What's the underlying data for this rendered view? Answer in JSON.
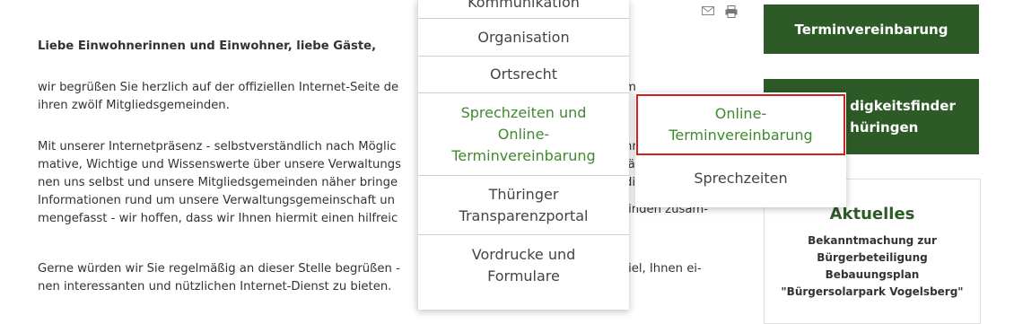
{
  "content": {
    "greeting": "Liebe Einwohnerinnen und Einwohner, liebe Gäste,",
    "p1_line1": "wir begrüßen Sie herzlich auf der offiziellen Internet-Seite de",
    "p1_line2": "ihren zwölf Mitgliedsgemeinden.",
    "p2_line1": "Mit unserer Internetpräsenz - selbstverständlich nach Möglic",
    "p2_line2": "mative, Wichtige und Wissenswerte über unsere Verwaltungs",
    "p2_line3": "nen uns selbst und unsere Mitgliedsgemeinden näher bringe",
    "p2_line4": "Informationen rund um unsere Verwaltungsgemeinschaft un",
    "p2_line5": "mengefasst - wir hoffen, dass wir Ihnen hiermit einen hilfreic",
    "p3_line1": "Gerne würden wir Sie regelmäßig an dieser Stelle begrüßen -",
    "p3_line2": "nen interessanten und nützlichen Internet-Dienst zu bieten.",
    "frag_m": "m",
    "frag_nr": "nr",
    "frag_la": "lä",
    "frag_di": "di",
    "frag_einden": "einden zusam-",
    "frag_ziel": "s Ziel, Ihnen ei-"
  },
  "icons": {
    "mail": "mail-icon",
    "print": "print-icon"
  },
  "menu": {
    "items": [
      {
        "label": "Kommunikation"
      },
      {
        "label": "Organisation"
      },
      {
        "label": "Ortsrecht"
      },
      {
        "label": "Sprechzeiten und Online-Terminvereinbarung"
      },
      {
        "label": "Thüringer Transparenzportal"
      },
      {
        "label": "Vordrucke und Formulare"
      }
    ]
  },
  "submenu": {
    "online": "Online-Terminvereinbarung",
    "sprech": "Sprechzeiten"
  },
  "sidebar": {
    "termin_btn": "Terminvereinbarung",
    "zust_btn_line1": "digkeitsfinder",
    "zust_btn_line2": "hüringen",
    "aktuell_title": "Aktuelles",
    "news_line1": "Bekanntmachung zur",
    "news_line2": "Bürgerbeteiligung",
    "news_line3": "Bebauungsplan",
    "news_line4": "\"Bürgersolarpark Vogelsberg\""
  },
  "colors": {
    "brand_green": "#2d5a27",
    "link_green": "#3f8a2f",
    "highlight_red": "#d0201f"
  }
}
